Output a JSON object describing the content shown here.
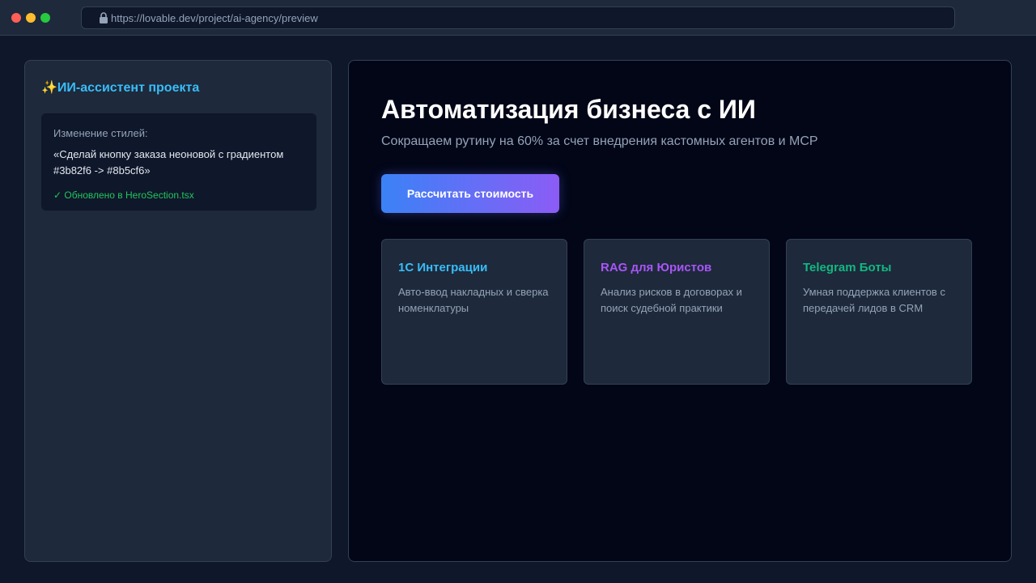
{
  "browser": {
    "url": "https://lovable.dev/project/ai-agency/preview"
  },
  "assistant": {
    "title": "✨ИИ-ассистент проекта",
    "message": {
      "label": "Изменение стилей:",
      "text": "«Сделай кнопку заказа неоновой с градиентом #3b82f6 -> #8b5cf6»",
      "status": "✓ Обновлено в HeroSection.tsx"
    }
  },
  "hero": {
    "title": "Автоматизация бизнеса с ИИ",
    "subtitle": "Сокращаем рутину на 60% за счет внедрения кастомных агентов и MCP",
    "cta_label": "Рассчитать стоимость",
    "cta_gradient": [
      "#3b82f6",
      "#8b5cf6"
    ]
  },
  "cards": [
    {
      "title": "1С Интеграции",
      "description": "Авто-ввод накладных и сверка номенклатуры",
      "accent": "#38bdf8"
    },
    {
      "title": "RAG для Юристов",
      "description": "Анализ рисков в договорах и поиск судебной практики",
      "accent": "#a855f7"
    },
    {
      "title": "Telegram Боты",
      "description": "Умная поддержка клиентов с передачей лидов в CRM",
      "accent": "#10b981"
    }
  ],
  "colors": {
    "background": "#0f172a",
    "panel": "#1e293b",
    "preview_bg": "#020617",
    "assistant_accent": "#38bdf8",
    "success": "#22c55e"
  }
}
